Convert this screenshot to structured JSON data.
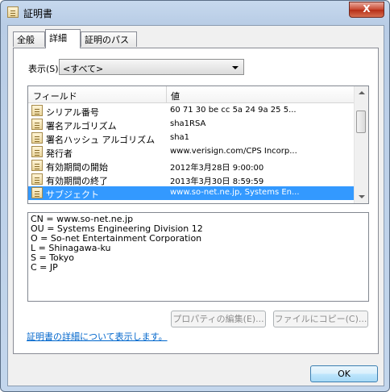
{
  "window": {
    "title": "証明書",
    "close_label": "X"
  },
  "tabs": [
    {
      "label": "全般"
    },
    {
      "label": "詳細"
    },
    {
      "label": "証明のパス"
    }
  ],
  "show": {
    "label": "表示(S):",
    "selected": "<すべて>"
  },
  "list": {
    "columns": [
      "フィールド",
      "値"
    ],
    "rows": [
      {
        "field": "シリアル番号",
        "value": "60 71 30 be cc 5a 24 9a 25 5..."
      },
      {
        "field": "署名アルゴリズム",
        "value": "sha1RSA"
      },
      {
        "field": "署名ハッシュ アルゴリズム",
        "value": "sha1"
      },
      {
        "field": "発行者",
        "value": "www.verisign.com/CPS Incorp..."
      },
      {
        "field": "有効期間の開始",
        "value": "2012年3月28日 9:00:00"
      },
      {
        "field": "有効期間の終了",
        "value": "2013年3月30日 8:59:59"
      },
      {
        "field": "サブジェクト",
        "value": "www.so-net.ne.jp, Systems En..."
      }
    ]
  },
  "detail_lines": [
    "CN = www.so-net.ne.jp",
    "OU = Systems Engineering Division 12",
    "O = So-net Entertainment Corporation",
    "L = Shinagawa-ku",
    "S = Tokyo",
    "C = JP"
  ],
  "buttons": {
    "edit_properties": "プロパティの編集(E)...",
    "copy_to_file": "ファイルにコピー(C)...",
    "ok": "OK"
  },
  "link": "証明書の詳細について表示します。",
  "colors": {
    "selection": "#3399ff",
    "link": "#0066cc",
    "close": "#c7472f"
  }
}
